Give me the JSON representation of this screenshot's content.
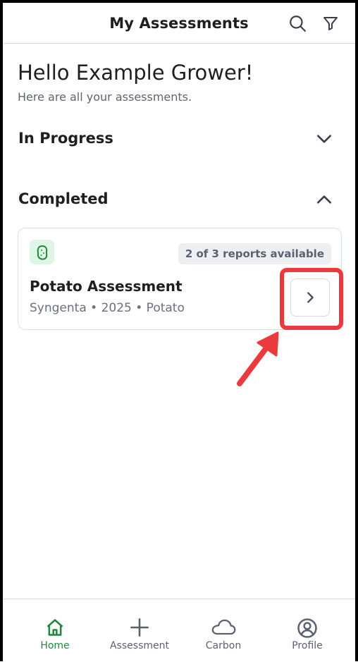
{
  "header": {
    "title": "My Assessments"
  },
  "greeting": {
    "title": "Hello Example Grower!",
    "subtitle": "Here are all your assessments."
  },
  "sections": {
    "in_progress": {
      "label": "In Progress",
      "expanded": false
    },
    "completed": {
      "label": "Completed",
      "expanded": true
    }
  },
  "assessments": [
    {
      "icon": "potato-icon",
      "reports": "2 of 3 reports available",
      "title": "Potato Assessment",
      "meta": "Syngenta • 2025 • Potato"
    }
  ],
  "bottom_nav": {
    "items": [
      {
        "label": "Home",
        "icon": "home-icon",
        "active": true
      },
      {
        "label": "Assessment",
        "icon": "plus-icon",
        "active": false
      },
      {
        "label": "Carbon",
        "icon": "cloud-icon",
        "active": false
      },
      {
        "label": "Profile",
        "icon": "profile-icon",
        "active": false
      }
    ]
  },
  "colors": {
    "accent_green": "#1f8a3b",
    "highlight_red": "#ea3a3d",
    "badge_green_bg": "#dff5e6",
    "card_border": "#cfe8db"
  }
}
